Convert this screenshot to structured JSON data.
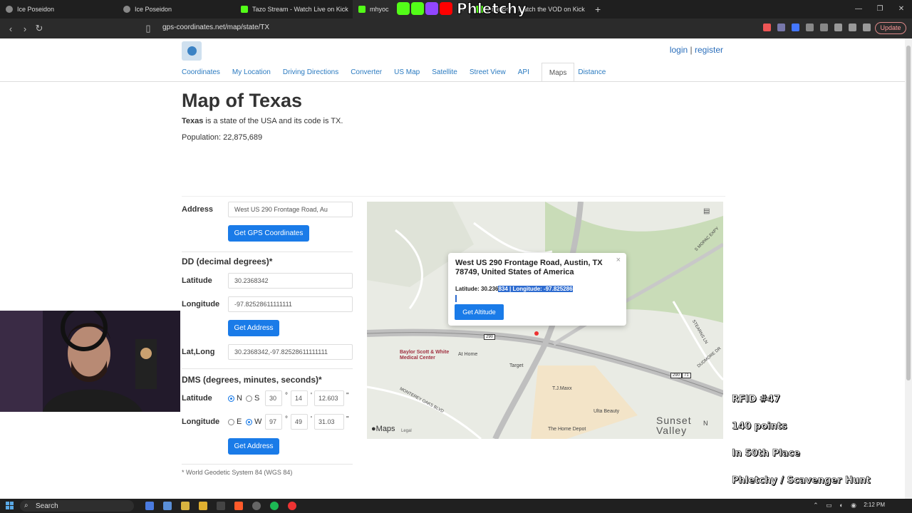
{
  "browser": {
    "tabs": [
      {
        "label": "Ice Poseidon",
        "icon_color": "#888888"
      },
      {
        "label": "Ice Poseidon",
        "icon_color": "#888888"
      },
      {
        "label": "Tazo Stream - Watch Live on Kick",
        "icon_color": "#53fc18"
      },
      {
        "label": "mhyoc",
        "icon_color": "#53fc18"
      },
      {
        "label": "Phletchy - Watch the VOD on Kick",
        "icon_color": "#53fc18"
      }
    ],
    "new_tab": "+",
    "url": "gps-coordinates.net/map/state/TX",
    "update_label": "Update"
  },
  "stream_overlay": {
    "logo_text": "Phletchy",
    "stats": [
      "RFID #47",
      "140 points",
      "In 50th Place",
      "Phletchy / Scavenger Hunt"
    ]
  },
  "site": {
    "auth": {
      "login": "login",
      "separator": "|",
      "register": "register"
    },
    "nav": [
      "Coordinates",
      "My Location",
      "Driving Directions",
      "Converter",
      "US Map",
      "Satellite",
      "Street View",
      "API",
      "Maps",
      "Distance"
    ],
    "active_nav": "Maps"
  },
  "page": {
    "title": "Map of Texas",
    "desc_bold": "Texas",
    "desc_rest": " is a state of the USA and its code is TX.",
    "population": "Population: 22,875,689"
  },
  "form": {
    "address_label": "Address",
    "address_value": "West US 290 Frontage Road, Au",
    "get_gps_button": "Get GPS Coordinates",
    "dd_heading": "DD (decimal degrees)*",
    "latitude_label": "Latitude",
    "latitude_value": "30.2368342",
    "longitude_label": "Longitude",
    "longitude_value": "-97.82528611111111",
    "get_address_button": "Get Address",
    "latlong_label": "Lat,Long",
    "latlong_value": "30.2368342,-97.82528611111111",
    "dms_heading": "DMS (degrees, minutes, seconds)*",
    "dms_lat": {
      "label": "Latitude",
      "opt1": "N",
      "opt2": "S",
      "selected": "N",
      "deg": "30",
      "min": "14",
      "sec": "12.603"
    },
    "dms_lon": {
      "label": "Longitude",
      "opt1": "E",
      "opt2": "W",
      "selected": "W",
      "deg": "97",
      "min": "49",
      "sec": "31.03"
    },
    "degree_sym": "°",
    "minute_sym": "'",
    "second_sym": "\"",
    "footnote": "* World Geodetic System 84 (WGS 84)"
  },
  "map": {
    "popup_title": "West US 290 Frontage Road, Austin, TX 78749, United States of America",
    "popup_close": "×",
    "popup_lat_prefix": "Latitude: 30.236",
    "popup_lat_selected": "834 | Longitude: -97.825286",
    "get_altitude_button": "Get Altitude",
    "places": [
      "Baylor Scott & White Medical Center",
      "At Home",
      "Target",
      "T.J.Maxx",
      "Ulta Beauty",
      "The Home Depot",
      "MONTEREY OAKS BLVD",
      "STEARNS LN",
      "DUDMORE DR",
      "S MOPAC EXPY"
    ],
    "area_label": "Sunset Valley",
    "shields": [
      "290",
      "290",
      "71"
    ],
    "attribution": "Maps",
    "legal": "Legal",
    "compass": "N"
  },
  "taskbar": {
    "search": "Search",
    "time": "2:12 PM"
  }
}
